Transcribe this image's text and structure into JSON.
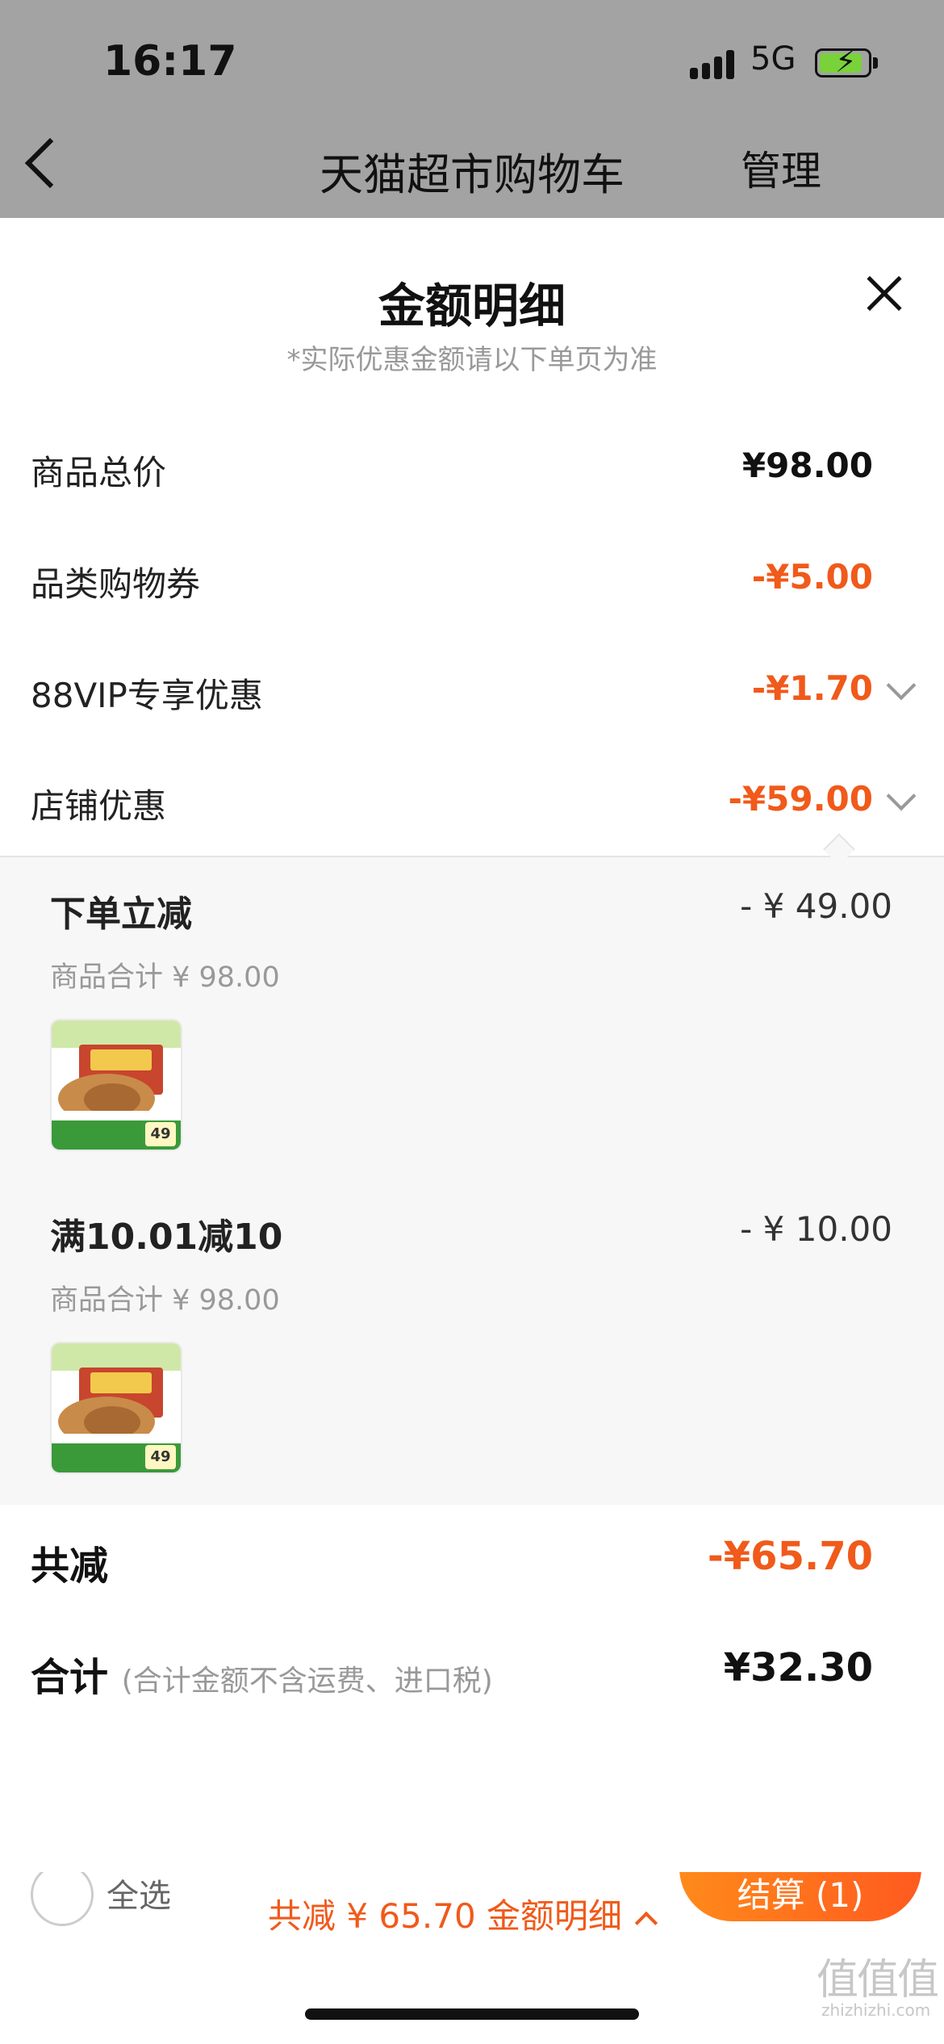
{
  "status_bar": {
    "time": "16:17",
    "network": "5G"
  },
  "nav": {
    "title": "天猫超市购物车",
    "manage": "管理"
  },
  "sheet": {
    "title": "金额明细",
    "note": "*实际优惠金额请以下单页为准",
    "rows": [
      {
        "label": "商品总价",
        "value": "¥98.00"
      },
      {
        "label": "品类购物券",
        "value": "-¥5.00"
      },
      {
        "label": "88VIP专享优惠",
        "value": "-¥1.70"
      },
      {
        "label": "店铺优惠",
        "value": "-¥59.00"
      }
    ],
    "discounts": [
      {
        "title": "下单立减",
        "amount": "- ¥ 49.00",
        "subtotal": "商品合计 ¥ 98.00",
        "badge": "49"
      },
      {
        "title": "满10.01减10",
        "amount": "- ¥ 10.00",
        "subtotal": "商品合计 ¥ 98.00",
        "badge": "49"
      }
    ],
    "total_discount": {
      "label": "共减",
      "value": "-¥65.70"
    },
    "total": {
      "label": "合计",
      "note": "(合计金额不含运费、进口税)",
      "value": "¥32.30"
    }
  },
  "bottom_bar": {
    "select_all": "全选",
    "checkout": "结算 (1)",
    "summary": "共减 ¥ 65.70  金额明细"
  },
  "watermark": {
    "main": "值值值",
    "sub": "zhizhizhi.com"
  },
  "colors": {
    "accent": "#f05a1a",
    "dim": "#a3a3a3",
    "panel": "#f7f7f7"
  }
}
